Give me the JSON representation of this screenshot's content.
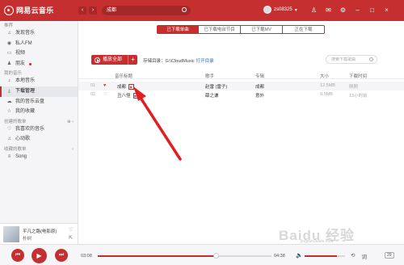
{
  "app": {
    "name": "网易云音乐"
  },
  "topbar": {
    "search_value": "成都",
    "username": "zs08325",
    "icons": [
      "shirt-icon",
      "mail-icon",
      "settings-icon",
      "minimize-icon",
      "maximize-icon",
      "close-icon"
    ]
  },
  "sidebar": {
    "recommend_header": "推荐",
    "recommend_items": [
      {
        "label": "发现音乐",
        "icon": "♫"
      },
      {
        "label": "私人FM",
        "icon": "◉"
      },
      {
        "label": "视频",
        "icon": "▭"
      },
      {
        "label": "朋友",
        "icon": "♟"
      }
    ],
    "my_music_header": "我的音乐",
    "my_music_items": [
      {
        "label": "本地音乐",
        "icon": "♪"
      },
      {
        "label": "下载管理",
        "icon": "⤓"
      },
      {
        "label": "我的音乐云盘",
        "icon": "☁"
      },
      {
        "label": "我的收藏",
        "icon": "☆"
      }
    ],
    "created_header": "创建的歌单",
    "created_items": [
      {
        "label": "我喜欢的音乐",
        "icon": "♡"
      },
      {
        "label": "心动歌",
        "icon": "♫"
      }
    ],
    "collected_header": "收藏的歌单",
    "collected_items": [
      {
        "label": "Song",
        "icon": "≡"
      }
    ]
  },
  "now_playing": {
    "title": "平凡之路(电影原)",
    "artist": "朴树"
  },
  "tabs": [
    "已下载单曲",
    "已下载电台节目",
    "已下载MV",
    "正在下载"
  ],
  "toolbar": {
    "play_all": "播放全部",
    "plus": "+",
    "dir_label": "存储目录：G:\\CloudMusic",
    "open_dir": "打开目录",
    "filter_placeholder": "搜索下载歌曲"
  },
  "table": {
    "headers": [
      "音乐标题",
      "歌手",
      "专辑",
      "大小",
      "下载时间"
    ],
    "rows": [
      {
        "num": "01",
        "liked": true,
        "title": "成都",
        "artist": "赵雷 (雷子)",
        "album": "成都",
        "size": "12.5MB",
        "time": "刚刚"
      },
      {
        "num": "02",
        "liked": false,
        "title": "丑八怪",
        "artist": "薛之谦",
        "album": "意外",
        "size": "9.5MB",
        "time": "13小时前"
      }
    ]
  },
  "player": {
    "current_time": "03:08",
    "total_time": "04:38",
    "progress": 0.68,
    "volume": 0.8,
    "count": "29"
  },
  "watermark": {
    "text": "Baidu 经验",
    "sub": "jingyan.baidu.com"
  }
}
